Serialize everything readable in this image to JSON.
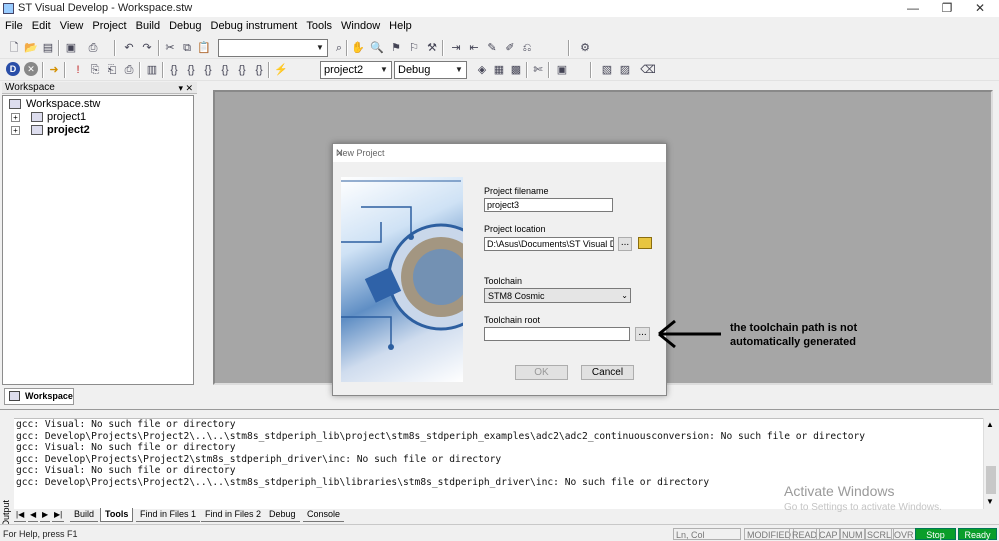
{
  "window": {
    "title": "ST Visual Develop - Workspace.stw",
    "controls": [
      "—",
      "❐",
      "✕"
    ]
  },
  "menu": [
    "File",
    "Edit",
    "View",
    "Project",
    "Build",
    "Debug",
    "Debug instrument",
    "Tools",
    "Window",
    "Help"
  ],
  "toolbar": {
    "project_select": "project2",
    "config_select": "Debug",
    "search_value": ""
  },
  "workspace": {
    "header": "Workspace",
    "pin": "▾ ✕",
    "root": "Workspace.stw",
    "projects": [
      {
        "name": "project1",
        "bold": false
      },
      {
        "name": "project2",
        "bold": true
      }
    ],
    "tab": "Workspace"
  },
  "dialog": {
    "title": "New Project",
    "close": "✕",
    "filename_label": "Project filename",
    "filename_value": "project3",
    "location_label": "Project location",
    "location_value": "D:\\Asus\\Documents\\ST Visual Dev",
    "browse": "...",
    "toolchain_label": "Toolchain",
    "toolchain_value": "STM8 Cosmic",
    "root_label": "Toolchain root",
    "root_value": "",
    "ok": "OK",
    "cancel": "Cancel"
  },
  "annotation": {
    "line1": "the toolchain path is not",
    "line2": "automatically generated"
  },
  "output": {
    "label": "Output",
    "lines": [
      "gcc: Visual: No such file or directory",
      "gcc: Develop\\Projects\\Project2\\..\\..\\stm8s_stdperiph_lib\\project\\stm8s_stdperiph_examples\\adc2\\adc2_continuousconversion: No such file or directory",
      "gcc: Visual: No such file or directory",
      "gcc: Develop\\Projects\\Project2\\stm8s_stdperiph_driver\\inc: No such file or directory",
      "gcc: Visual: No such file or directory",
      "gcc: Develop\\Projects\\Project2\\..\\..\\stm8s_stdperiph_lib\\libraries\\stm8s_stdperiph_driver\\inc: No such file or directory"
    ],
    "tabs": [
      "Build",
      "Tools",
      "Find in Files 1",
      "Find in Files 2",
      "Debug",
      "Console"
    ],
    "active_tab": "Tools"
  },
  "watermark": {
    "line1": "Activate Windows",
    "line2": "Go to Settings to activate Windows."
  },
  "status": {
    "help": "For Help, press F1",
    "lncol": "Ln, Col",
    "indicators": [
      "MODIFIED",
      "READ",
      "CAP",
      "NUM",
      "SCRL",
      "OVR"
    ],
    "stop": "Stop",
    "ready": "Ready",
    "green": "#0a9e2a"
  }
}
